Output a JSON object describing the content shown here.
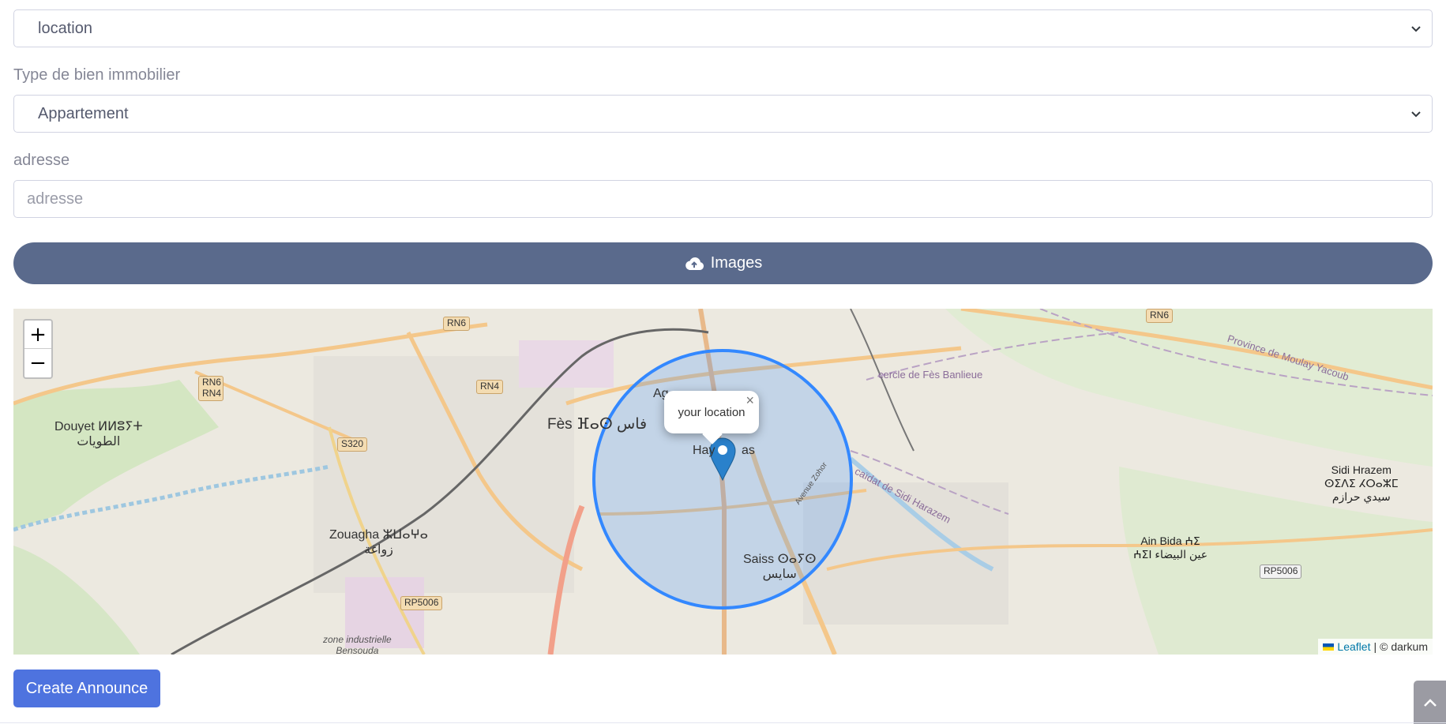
{
  "form": {
    "transaction_select": {
      "value": "location"
    },
    "property_type": {
      "label": "Type de bien immobilier",
      "value": "Appartement"
    },
    "address": {
      "label": "adresse",
      "placeholder": "adresse",
      "value": ""
    },
    "images_button": {
      "label": "Images",
      "icon": "cloud-upload-icon"
    },
    "create_button": {
      "label": "Create Announce"
    }
  },
  "map": {
    "zoom_in": "+",
    "zoom_out": "−",
    "popup": {
      "text": "your location",
      "close": "×"
    },
    "attribution": {
      "leaflet": "Leaflet",
      "separator": "|",
      "provider": "© darkum"
    },
    "labels": {
      "douyet": "Douyet ⵍⵍⵓⵢⵜ",
      "douyet_ar": "الطويات",
      "fes": "Fès ⴼⴰⵙ فاس",
      "zouagha": "Zouagha ⵣⵡⴰⵖⴰ",
      "zouagha_ar": "زواغة",
      "saiss": "Saiss ⵙⴰⵢⵙ",
      "saiss_ar": "سايس",
      "sidi_hrazem": "Sidi Hrazem",
      "sidi_hrazem_tf": "ⵙⵉⴷⵉ ⵃⵔⴰⵣⵎ",
      "sidi_hrazem_ar": "سيدي حرازم",
      "ain_bida": "Ain Bida ⵄⵉ",
      "ain_bida_ar": "ⵄⵉⵏ عين البيضاء",
      "zone_industrielle": "zone industrielle",
      "bensouda": "Bensouda",
      "hay": "Hay",
      "hay_suffix": "as",
      "agd": "Ag",
      "cercle": "cercle de Fès Banlieue",
      "province": "Province de Moulay Yacoub",
      "caidat": "caïdat de Sidi Harazem",
      "avenue": "Avenue Zohor"
    },
    "road_tags": {
      "rn6_top": "RN6",
      "rn6_left": "RN6",
      "rn4_left": "RN4",
      "rn4": "RN4",
      "s320": "S320",
      "rp5006_left": "RP5006",
      "rp5006_right": "RP5006",
      "rn6_right": "RN6"
    },
    "colors": {
      "circle": "#3388ff",
      "circle_fill": "#3388ff",
      "marker": "#2a81cb"
    }
  }
}
